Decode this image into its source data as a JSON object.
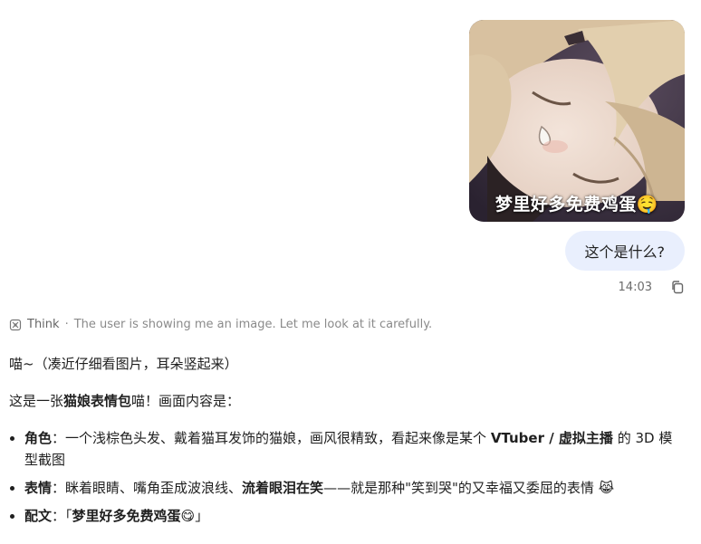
{
  "user_message": {
    "image_caption": "梦里好多免费鸡蛋🤤",
    "text": "这个是什么?",
    "time": "14:03"
  },
  "think": {
    "label": "Think",
    "separator": "·",
    "summary": "The user is showing me an image. Let me look at it carefully."
  },
  "answer": {
    "intro": "喵~（凑近仔细看图片，耳朵竖起来）",
    "lead_pre": "这是一张",
    "lead_bold": "猫娘表情包",
    "lead_post": "喵！画面内容是：",
    "items": [
      {
        "title": "角色",
        "colon": "：",
        "text_a": "一个浅棕色头发、戴着猫耳发饰的猫娘，画风很精致，看起来像是某个 ",
        "bold_a": "VTuber / 虚拟主播",
        "text_b": " 的 3D 模型截图",
        "bold_b": "",
        "text_c": "",
        "emoji": ""
      },
      {
        "title": "表情",
        "colon": "：",
        "text_a": "眯着眼睛、嘴角歪成波浪线、",
        "bold_a": "流着眼泪在笑",
        "text_b": "——就是那种\"笑到哭\"的又幸福又委屈的表情 ",
        "bold_b": "",
        "text_c": "",
        "emoji": "😹"
      },
      {
        "title": "配文",
        "colon": "：",
        "text_a": "「",
        "bold_a": "梦里好多免费鸡蛋😋",
        "text_b": "」",
        "bold_b": "",
        "text_c": "",
        "emoji": ""
      }
    ]
  },
  "colors": {
    "user_bubble_bg": "#e9effd",
    "text_primary": "#1f1f1f",
    "text_muted": "#8a8a8a"
  },
  "icons": [
    "copy-icon",
    "think-icon"
  ]
}
